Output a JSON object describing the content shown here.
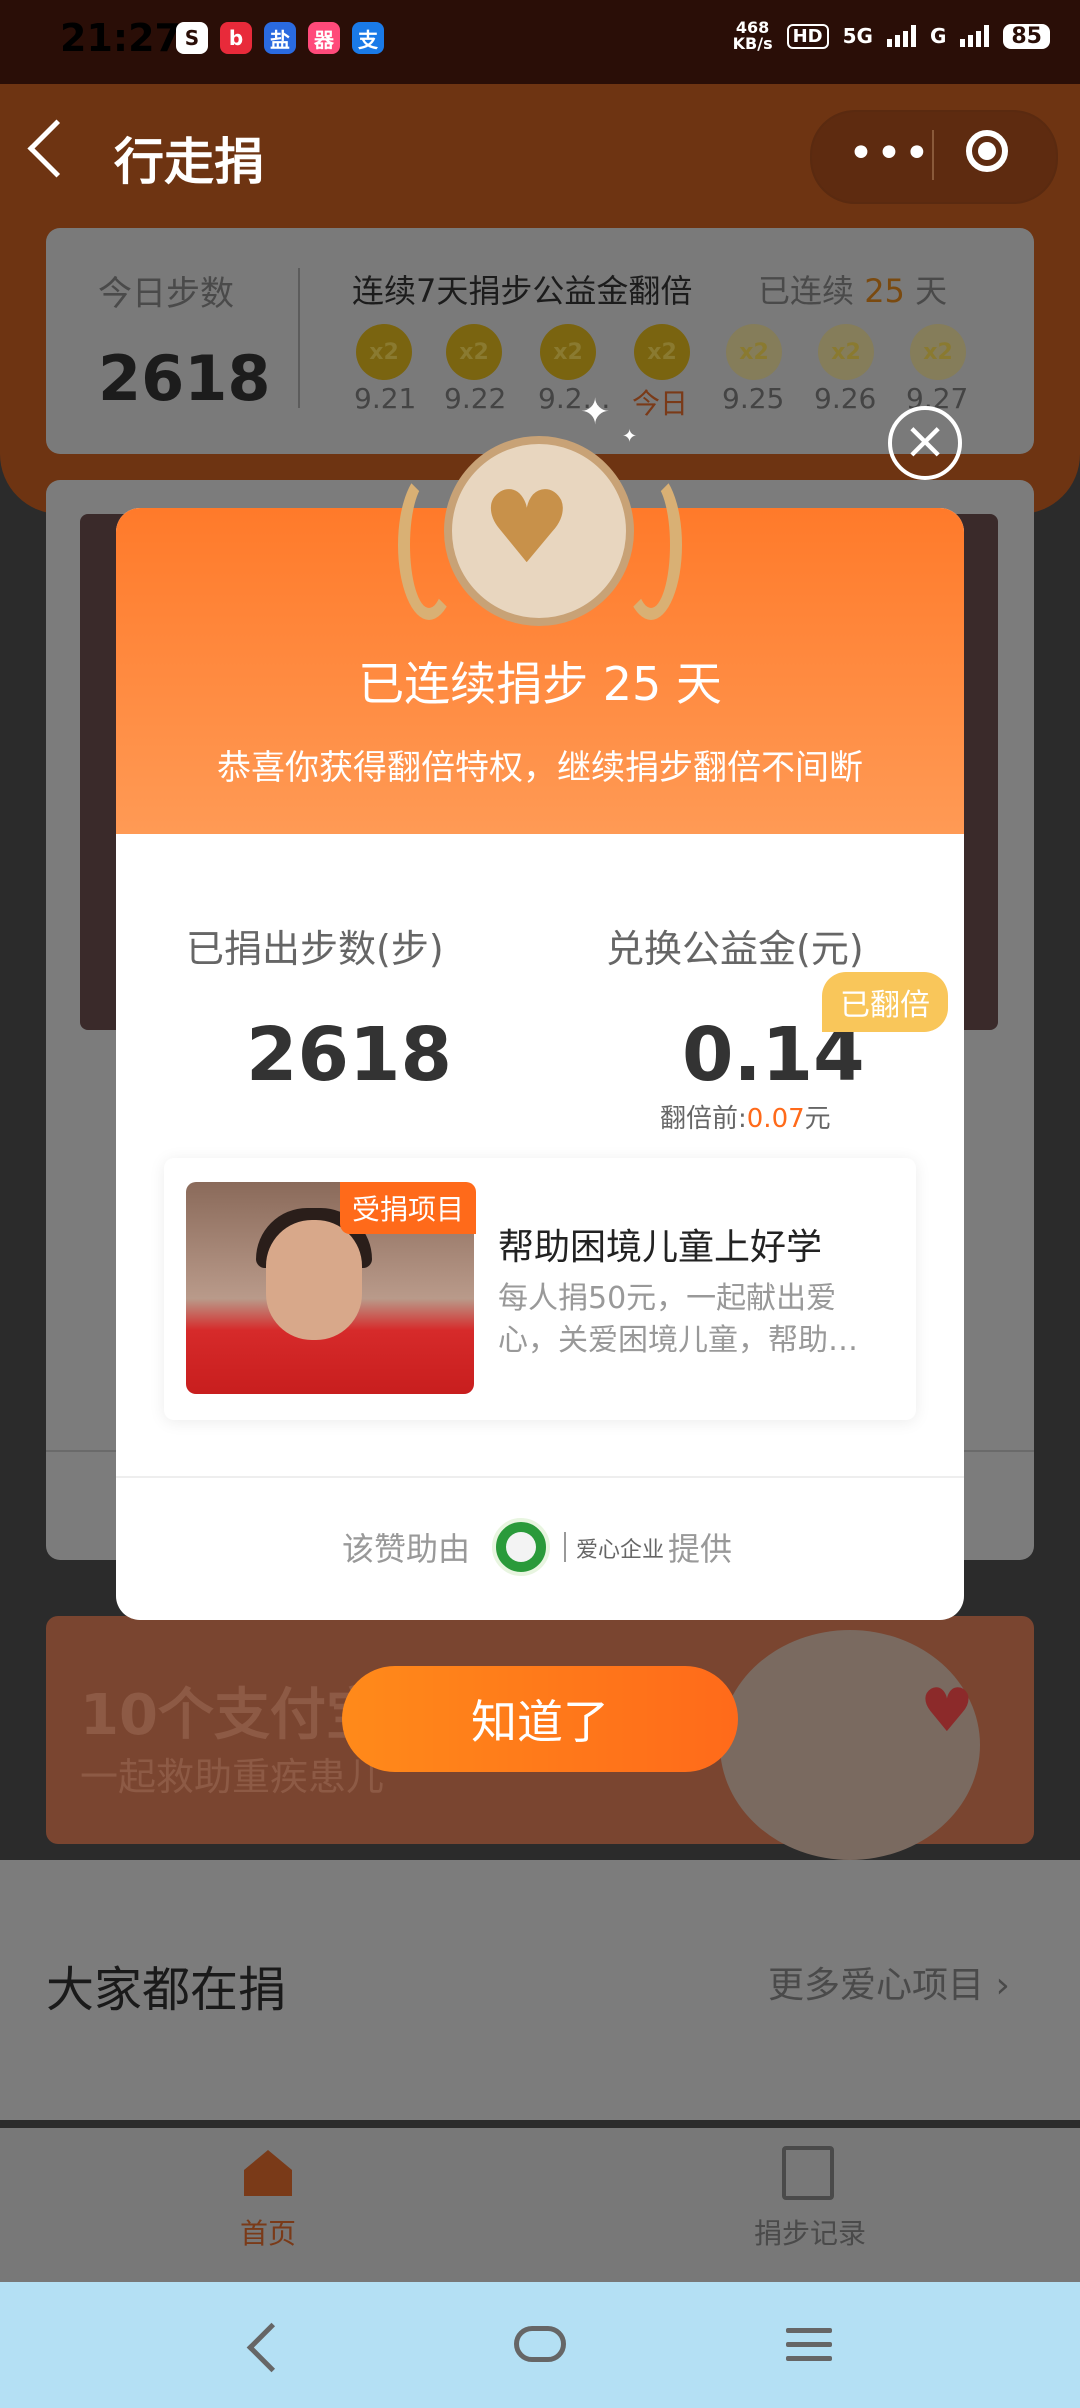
{
  "status_bar": {
    "time": "21:27",
    "network_speed_value": "468",
    "network_speed_unit": "KB/s",
    "hd": "HD",
    "signal_1": "5G",
    "signal_2": "G",
    "battery": "85",
    "app_icons": [
      {
        "icon": "app-icon-1",
        "glyph": "S",
        "color": "#ffffff"
      },
      {
        "icon": "app-icon-2",
        "glyph": "b",
        "color": "#e82a3a"
      },
      {
        "icon": "app-icon-3",
        "glyph": "盐",
        "color": "#2a6ae0"
      },
      {
        "icon": "app-icon-4",
        "glyph": "器",
        "color": "#ff4a7a"
      },
      {
        "icon": "alipay-icon",
        "glyph": "支",
        "color": "#1a7ae8"
      }
    ]
  },
  "header": {
    "title": "行走捐",
    "more": "•••"
  },
  "steps_card": {
    "today_label": "今日步数",
    "today_count": "2618",
    "streak_title": "连续7天捐步公益金翻倍",
    "streak_prefix": "已连续",
    "streak_days": "25",
    "streak_suffix": "天",
    "coin_label": "x2",
    "dates": [
      "9.21",
      "9.22",
      "9.2…",
      "今日",
      "9.25",
      "9.26",
      "9.27"
    ]
  },
  "background": {
    "banner_title": "10个支付宝",
    "banner_sub": "一起救助重疾患儿",
    "section_title": "大家都在捐",
    "section_more": "更多爱心项目 ›"
  },
  "tabbar": {
    "home": "首页",
    "records": "捐步记录"
  },
  "modal": {
    "close": "×",
    "title": "已连续捐步 25 天",
    "subtitle": "恭喜你获得翻倍特权，继续捐步翻倍不间断",
    "donated_label": "已捐出步数(步)",
    "donated_value": "2618",
    "fund_label": "兑换公益金(元)",
    "fund_value": "0.14",
    "badge": "已翻倍",
    "before_prefix": "翻倍前:",
    "before_value": "0.07",
    "before_unit": "元",
    "project_tag": "受捐项目",
    "project_title": "帮助困境儿童上好学",
    "project_desc": "每人捐50元，一起献出爱心，关爱困境儿童，帮助…",
    "sponsor_prefix": "该赞助由",
    "sponsor_name": "爱心企业",
    "sponsor_suffix": "提供",
    "ok_button": "知道了"
  },
  "colors": {
    "accent": "#ff6a1a",
    "modal_gradient_top": "#ff7a2a",
    "badge": "#f9c65a",
    "nav_bar": "#b4e0f4"
  }
}
